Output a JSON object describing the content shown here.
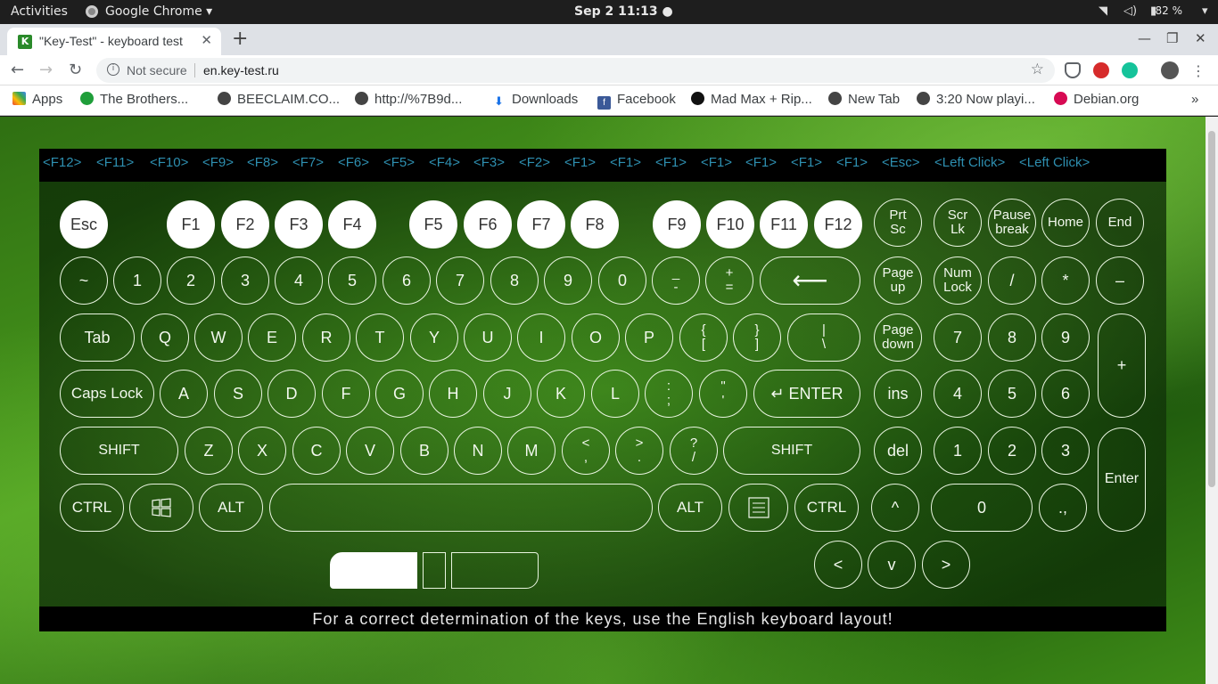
{
  "topbar": {
    "activities": "Activities",
    "app": "Google Chrome ▾",
    "clock": "Sep 2  11:13 ●",
    "battery": "82 %"
  },
  "browser": {
    "tab_title": "\"Key-Test\" - keyboard test",
    "tab_favicon": "K",
    "security": "Not secure",
    "url": "en.key-test.ru"
  },
  "bookmarks": [
    "Apps",
    "The Brothers...",
    "BEECLAIM.CO...",
    "http://%7B9d...",
    "Downloads",
    "Facebook",
    "Mad Max + Rip...",
    "New Tab",
    "3:20 Now playi...",
    "Debian.org"
  ],
  "keylog": [
    "<F12>",
    "<F11>",
    "<F10>",
    "<F9>",
    "<F8>",
    "<F7>",
    "<F6>",
    "<F5>",
    "<F4>",
    "<F3>",
    "<F2>",
    "<F1>",
    "<F1>",
    "<F1>",
    "<F1>",
    "<F1>",
    "<F1>",
    "<F1>",
    "<Esc>",
    "<Left Click>",
    "<Left Click>"
  ],
  "keys": {
    "esc": "Esc",
    "f": [
      "F1",
      "F2",
      "F3",
      "F4",
      "F5",
      "F6",
      "F7",
      "F8",
      "F9",
      "F10",
      "F11",
      "F12"
    ],
    "prtsc": "Prt\nSc",
    "scrlk": "Scr\nLk",
    "pause": "Pause\nbreak",
    "home": "Home",
    "end": "End",
    "num_row": [
      "~",
      "1",
      "2",
      "3",
      "4",
      "5",
      "6",
      "7",
      "8",
      "9",
      "0",
      "_\n-",
      "+\n="
    ],
    "backspace": "⟵",
    "pageup": "Page\nup",
    "numlock": "Num\nLock",
    "kp_slash": "/",
    "kp_star": "*",
    "kp_minus": "–",
    "tab": "Tab",
    "qrow": [
      "Q",
      "W",
      "E",
      "R",
      "T",
      "Y",
      "U",
      "I",
      "O",
      "P",
      "{\n[",
      "}\n]"
    ],
    "backslash": "|\n\\",
    "pagedown": "Page\ndown",
    "kp7": "7",
    "kp8": "8",
    "kp9": "9",
    "kp_plus": "+",
    "caps": "Caps Lock",
    "arow": [
      "A",
      "S",
      "D",
      "F",
      "G",
      "H",
      "J",
      "K",
      "L",
      ":\n;",
      "\"\n'"
    ],
    "enter": "↵ ENTER",
    "ins": "ins",
    "kp4": "4",
    "kp5": "5",
    "kp6": "6",
    "lshift": "SHIFT",
    "zrow": [
      "Z",
      "X",
      "C",
      "V",
      "B",
      "N",
      "M",
      "<\n,",
      ">\n.",
      "?\n/"
    ],
    "rshift": "SHIFT",
    "del": "del",
    "kp1": "1",
    "kp2": "2",
    "kp3": "3",
    "kp_enter": "Enter",
    "lctrl": "CTRL",
    "lalt": "ALT",
    "ralt": "ALT",
    "rctrl": "CTRL",
    "up": "^",
    "kp0": "0",
    "kp_dot": ".,",
    "left": "<",
    "down": "v",
    "right": ">"
  },
  "footer": "For a correct determination of the keys, use the English keyboard layout!"
}
